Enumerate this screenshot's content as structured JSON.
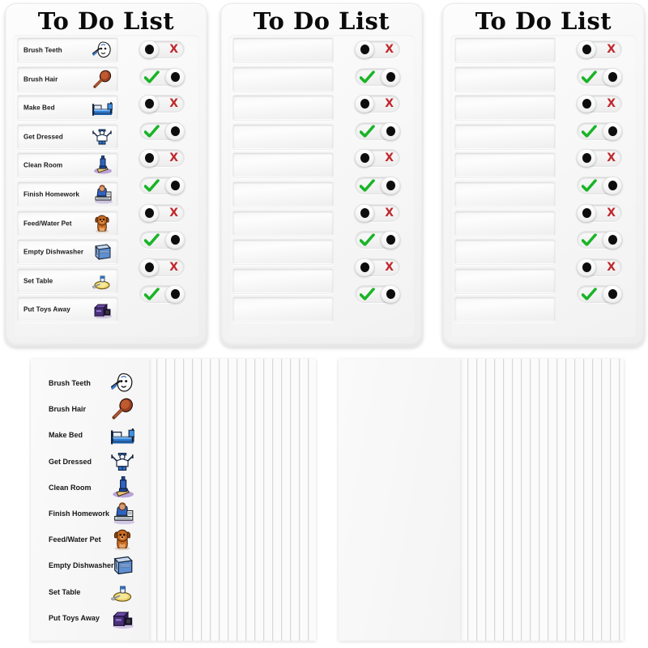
{
  "product": {
    "title": "To Do List",
    "background_color": "#ffffff"
  },
  "colors": {
    "check_green": "#19b427",
    "cross_red": "#c0282d",
    "knob_dot": "#0d0d0d",
    "board_white": "#f6f6f6",
    "text_dark": "#161616"
  },
  "chores": [
    {
      "label": "Brush Teeth",
      "icon": "toothbrush-icon",
      "state": "undone"
    },
    {
      "label": "Brush Hair",
      "icon": "hairbrush-icon",
      "state": "done"
    },
    {
      "label": "Make Bed",
      "icon": "bed-icon",
      "state": "undone"
    },
    {
      "label": "Get Dressed",
      "icon": "clothes-icon",
      "state": "done"
    },
    {
      "label": "Clean Room",
      "icon": "broom-icon",
      "state": "undone"
    },
    {
      "label": "Finish Homework",
      "icon": "homework-icon",
      "state": "done"
    },
    {
      "label": "Feed/Water Pet",
      "icon": "dog-icon",
      "state": "undone"
    },
    {
      "label": "Empty Dishwasher",
      "icon": "dishwasher-icon",
      "state": "done"
    },
    {
      "label": "Set Table",
      "icon": "plate-icon",
      "state": "undone"
    },
    {
      "label": "Put Toys Away",
      "icon": "toybox-icon",
      "state": "done"
    }
  ],
  "boards": [
    {
      "id": "board-1",
      "title": "To Do List",
      "cards_filled": true,
      "row_count": 10
    },
    {
      "id": "board-2",
      "title": "To Do List",
      "cards_filled": false,
      "row_count": 10
    },
    {
      "id": "board-3",
      "title": "To Do List",
      "cards_filled": false,
      "row_count": 10
    }
  ],
  "sheet_stacks": [
    {
      "id": "printed-card-stack",
      "printed": true,
      "sheet_count": 18
    },
    {
      "id": "blank-card-stack",
      "printed": false,
      "sheet_count": 20
    }
  ],
  "toggle": {
    "done_mark": "check",
    "undone_mark": "X",
    "undone_mark_text": "X"
  }
}
